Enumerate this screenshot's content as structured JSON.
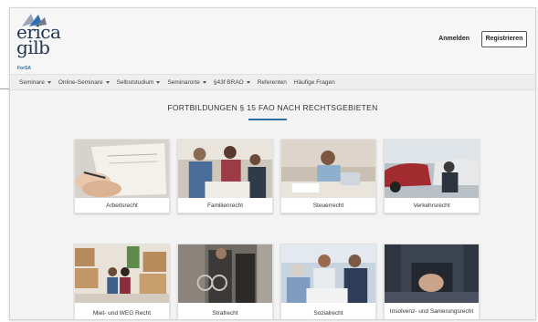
{
  "brand": {
    "logo_text": "erica\ngilb",
    "logo_sub": "ForSA"
  },
  "header": {
    "login_label": "Anmelden",
    "register_label": "Registrieren"
  },
  "nav": {
    "items": [
      {
        "label": "Seminare",
        "dropdown": true
      },
      {
        "label": "Online-Seminare",
        "dropdown": true
      },
      {
        "label": "Selbststudium",
        "dropdown": true
      },
      {
        "label": "Seminarorte",
        "dropdown": true
      },
      {
        "label": "§43f BRAO",
        "dropdown": true
      },
      {
        "label": "Referenten",
        "dropdown": false
      },
      {
        "label": "Häufige Fragen",
        "dropdown": false
      }
    ]
  },
  "main": {
    "title": "FORTBILDUNGEN § 15 FAO NACH RECHTSGEBIETEN",
    "cards": [
      {
        "label": "Arbeitsrecht"
      },
      {
        "label": "Familienrecht"
      },
      {
        "label": "Steuerrecht"
      },
      {
        "label": "Verkehrsrecht"
      },
      {
        "label": "Miet- und WEG Recht"
      },
      {
        "label": "Strafrecht"
      },
      {
        "label": "Sozialrecht"
      },
      {
        "label": "Insolvenz- und Sanierungsrecht"
      }
    ]
  },
  "colors": {
    "accent": "#2f6ea8",
    "logo_navy": "#1f3553",
    "logo_blue": "#2d6db5"
  }
}
